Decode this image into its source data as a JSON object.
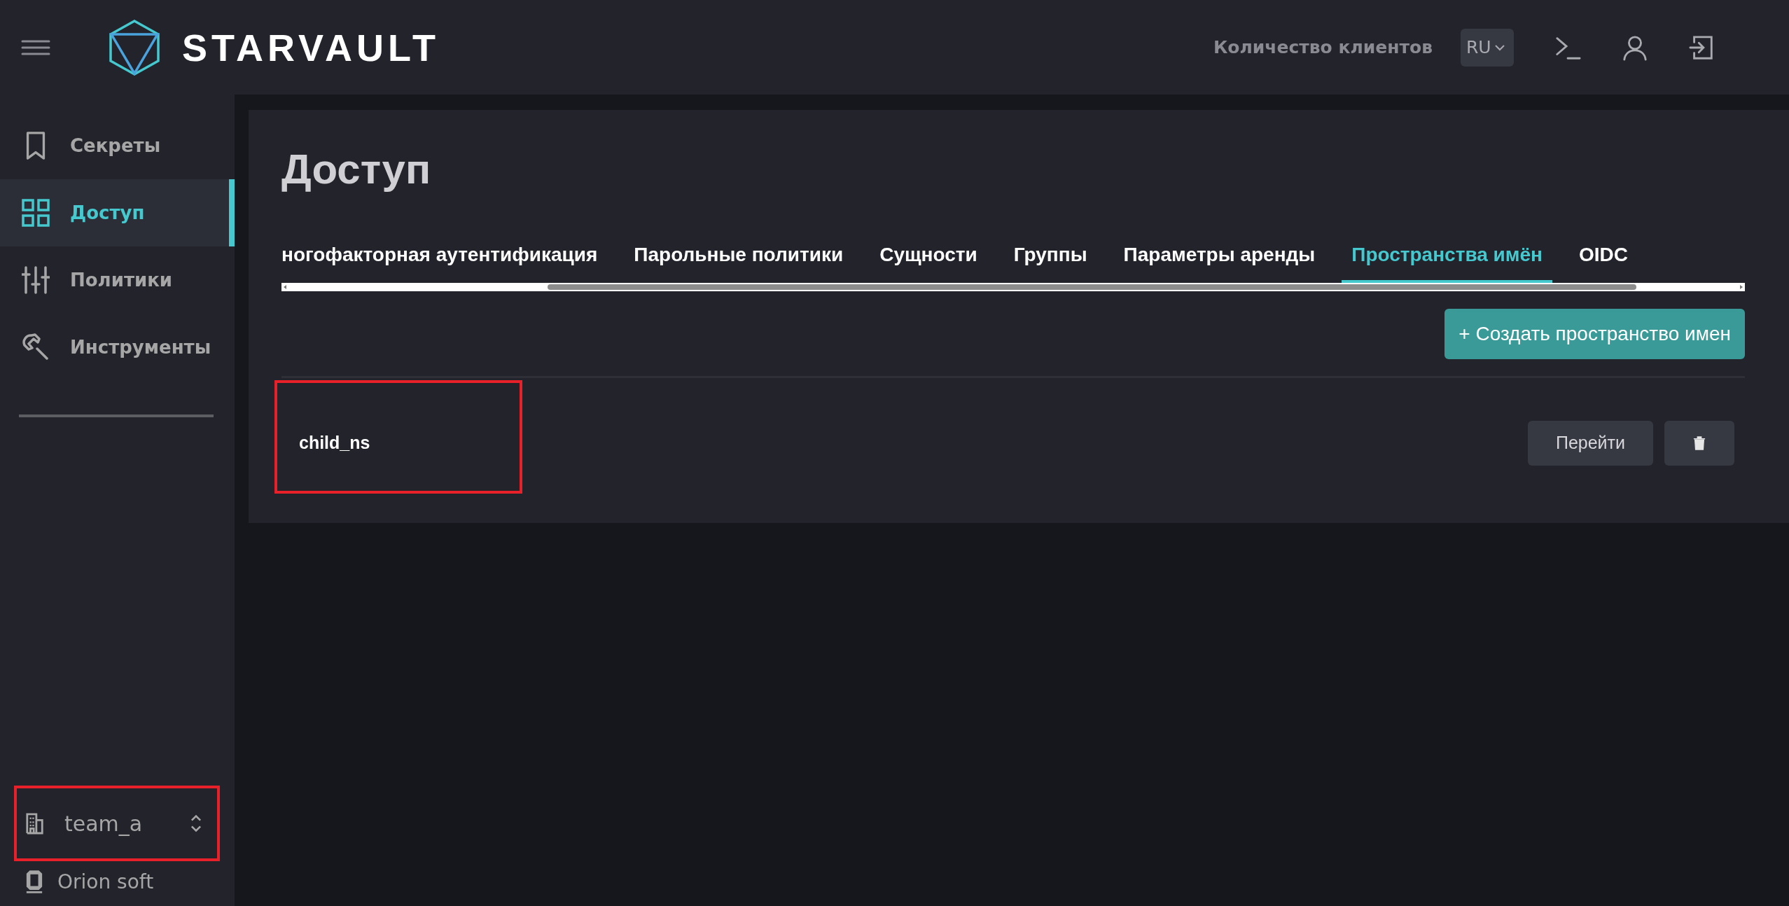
{
  "header": {
    "brand": "STARVAULT",
    "clients_link": "Количество клиентов",
    "language": "RU"
  },
  "sidebar": {
    "items": [
      {
        "label": "Секреты",
        "kind": "bookmark",
        "selected": false
      },
      {
        "label": "Доступ",
        "kind": "grid",
        "selected": true
      },
      {
        "label": "Политики",
        "kind": "sliders",
        "selected": false
      },
      {
        "label": "Инструменты",
        "kind": "wrench",
        "selected": false
      }
    ],
    "org": {
      "name": "team_a",
      "highlighted": true
    },
    "company": "Orion soft"
  },
  "page": {
    "title": "Доступ",
    "tabs": [
      {
        "label": "ногофакторная аутентификация",
        "selected": false
      },
      {
        "label": "Парольные политики",
        "selected": false
      },
      {
        "label": "Сущности",
        "selected": false
      },
      {
        "label": "Группы",
        "selected": false
      },
      {
        "label": "Параметры аренды",
        "selected": false
      },
      {
        "label": "Пространства имён",
        "selected": true
      },
      {
        "label": "OIDC",
        "selected": false
      }
    ],
    "create_button": "+ Создать пространство имен",
    "namespaces": [
      {
        "name": "child_ns",
        "highlighted": true,
        "open_button": "Перейти"
      }
    ]
  }
}
